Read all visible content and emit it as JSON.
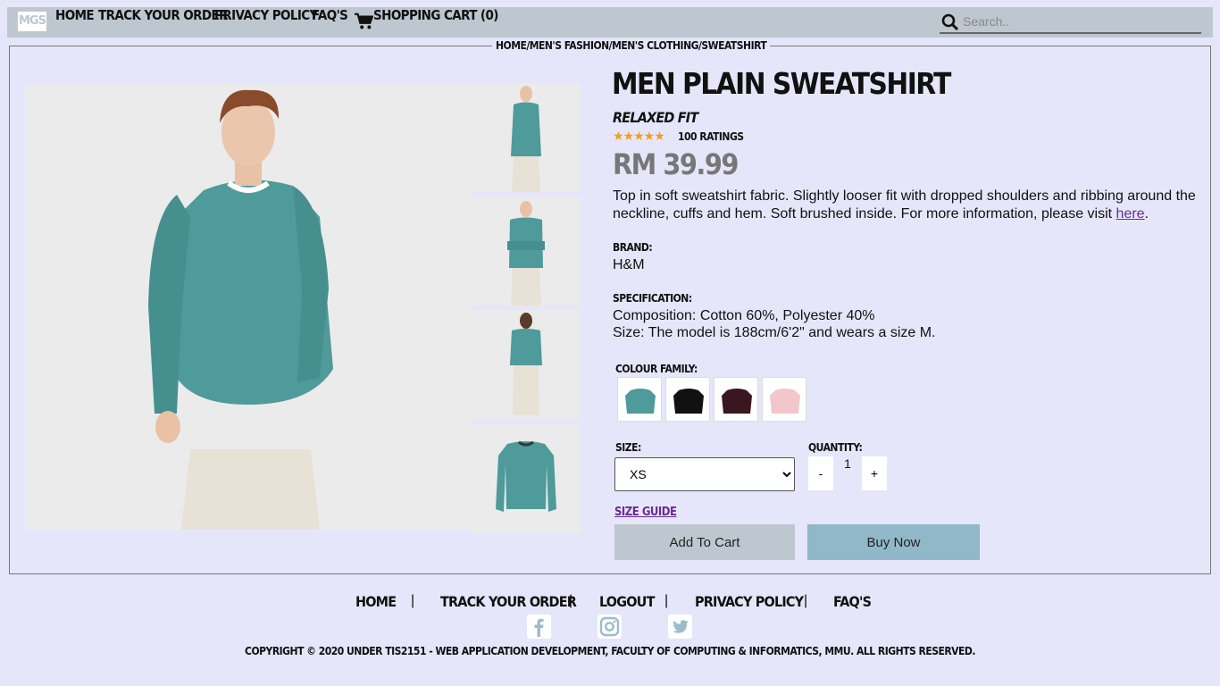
{
  "nav": {
    "logo": "MGS",
    "items": [
      "HOME",
      "TRACK YOUR ORDER",
      "PRIVACY POLICY",
      "FAQ'S"
    ],
    "cart_label": "SHOPPING CART (0)",
    "search_placeholder": "Search.."
  },
  "breadcrumb": "HOME/MEN'S FASHION/MEN'S CLOTHING/SWEATSHIRT",
  "product": {
    "title": "MEN PLAIN SWEATSHIRT",
    "fit": "RELAXED FIT",
    "stars": "★★★★★",
    "rating": 5,
    "ratings_label": "100 RATINGS",
    "price": "RM 39.99",
    "description": "Top in soft sweatshirt fabric. Slightly looser fit with dropped shoulders and ribbing around the neckline, cuffs and hem. Soft brushed inside. For more information, please visit",
    "link_text": "here",
    "brand_label": "BRAND:",
    "brand": "H&M",
    "spec_label": "SPECIFICATION:",
    "spec_composition": "Composition: Cotton 60%, Polyester 40%",
    "spec_size": "Size: The model is 188cm/6'2\" and wears a size M.",
    "colour_label": "COLOUR FAMILY:",
    "colours": [
      "#4f9a9a",
      "#111111",
      "#3a1620",
      "#f2c6cb"
    ],
    "size_label": "SIZE:",
    "size_selected": "XS",
    "quantity_label": "QUANTITY:",
    "qty_minus": "-",
    "quantity": "1",
    "qty_plus": "+",
    "size_guide": "SIZE GUIDE",
    "add_to_cart": "Add To Cart",
    "buy_now": "Buy Now"
  },
  "footer": {
    "links": [
      "HOME",
      "TRACK YOUR ORDER",
      "LOGOUT",
      "PRIVACY POLICY",
      "FAQ'S"
    ],
    "separator": "|",
    "copyright": "COPYRIGHT © 2020 UNDER TIS2151 - WEB APPLICATION DEVELOPMENT, FACULTY OF COMPUTING & INFORMATICS, MMU. ALL RIGHTS RESERVED."
  },
  "colors": {
    "nav_bg": "#bec7cf",
    "page_bg": "#e6e6fa",
    "sweater": "#4f9a9a",
    "buy_now_bg": "#91b8c8",
    "add_cart_bg": "#bec7cf",
    "link": "#6a2c91"
  },
  "icons": [
    "cart-icon",
    "search-icon",
    "facebook-icon",
    "instagram-icon",
    "twitter-icon"
  ]
}
